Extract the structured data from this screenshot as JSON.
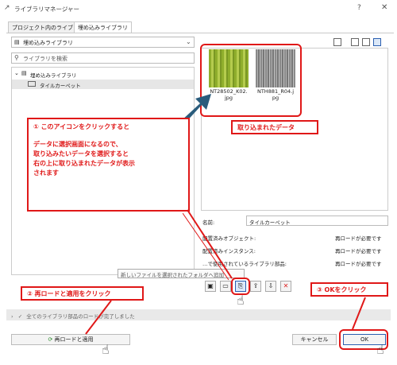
{
  "window": {
    "title": "ライブラリマネージャー",
    "help": "?",
    "close": "✕"
  },
  "tabs": [
    {
      "label": "プロジェクト内のライブラリ"
    },
    {
      "label": "埋め込みライブラリ"
    }
  ],
  "library_select": {
    "value": "埋め込みライブラリ",
    "icon": "library-icon"
  },
  "search": {
    "placeholder": "ライブラリを検索"
  },
  "tree": [
    {
      "label": "埋め込みライブラリ",
      "expanded": true
    },
    {
      "label": "タイルカーペット",
      "selected": true
    }
  ],
  "preview": {
    "files": [
      {
        "name": "NT28502_K02.jpg",
        "line1": "NT28502_K02.",
        "line2": "jpg",
        "swatch": "#9bb83a"
      },
      {
        "name": "NTH881_R04.jpg",
        "line1": "NTH881_R04.j",
        "line2": "pg",
        "swatch": "#9a9a9a"
      }
    ]
  },
  "details": {
    "name_label": "名前:",
    "name_value": "タイルカーペット",
    "placed_objects_label": "配置済みオブジェクト:",
    "placed_objects_value": "再ロードが必要です",
    "placed_instances_label": "配置済みインスタンス:",
    "placed_instances_value": "再ロードが必要です",
    "used_parts_label": "…で使用されているライブラリ部品:",
    "used_parts_value": "再ロードが必要です"
  },
  "tooltip": "新しいファイルを選択されたフォルダへ追加",
  "status": "全てのライブラリ部品のロードが完了しました",
  "buttons": {
    "reload": "再ロードと適用",
    "cancel": "キャンセル",
    "ok": "OK"
  },
  "annotations": {
    "note1_lines": [
      "① このアイコンをクリックすると",
      "",
      "データに選択画面になるので、",
      "取り込みたいデータを選択すると",
      "右の上に取り込まれたデータが表示",
      "されます"
    ],
    "note_imported": "取り込まれたデータ",
    "note2": "② 再ロードと適用をクリック",
    "note3": "③ OKをクリック"
  },
  "colors": {
    "annotation_red": "#e01818",
    "arrow_blue": "#2a5c7c"
  }
}
